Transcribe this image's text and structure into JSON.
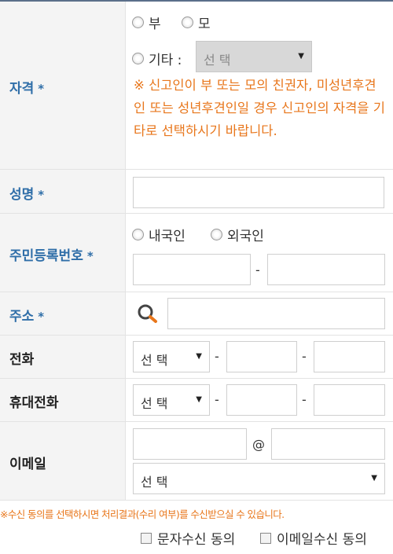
{
  "qualification": {
    "label": "자격",
    "required_mark": "*",
    "options": [
      "부",
      "모"
    ],
    "other_label": "기타 :",
    "other_select_value": "선 택",
    "notice": "※ 신고인이 부 또는 모의 친권자, 미성년후견인 또는 성년후견인일 경우 신고인의 자격을 기타로 선택하시기 바랍니다."
  },
  "name": {
    "label": "성명",
    "required_mark": "*",
    "value": ""
  },
  "resident_id": {
    "label": "주민등록번호",
    "required_mark": "*",
    "options": [
      "내국인",
      "외국인"
    ],
    "separator": "-",
    "part1": "",
    "part2": ""
  },
  "address": {
    "label": "주소",
    "required_mark": "*",
    "search_icon": "search-icon",
    "value": ""
  },
  "phone": {
    "label": "전화",
    "select_value": "선 택",
    "separator": "-"
  },
  "mobile": {
    "label": "휴대전화",
    "select_value": "선 택",
    "separator": "-"
  },
  "email": {
    "label": "이메일",
    "at": "@",
    "domain_select_value": "선 택"
  },
  "consent": {
    "notice": "※수신 동의를 선택하시면 처리결과(수리 여부)를 수신받으실 수 있습니다.",
    "sms_label": "문자수신 동의",
    "email_label": "이메일수신 동의"
  },
  "colors": {
    "required_label": "#2f6ea8",
    "notice": "#e8761b",
    "label_bg": "#f4f4f4"
  }
}
